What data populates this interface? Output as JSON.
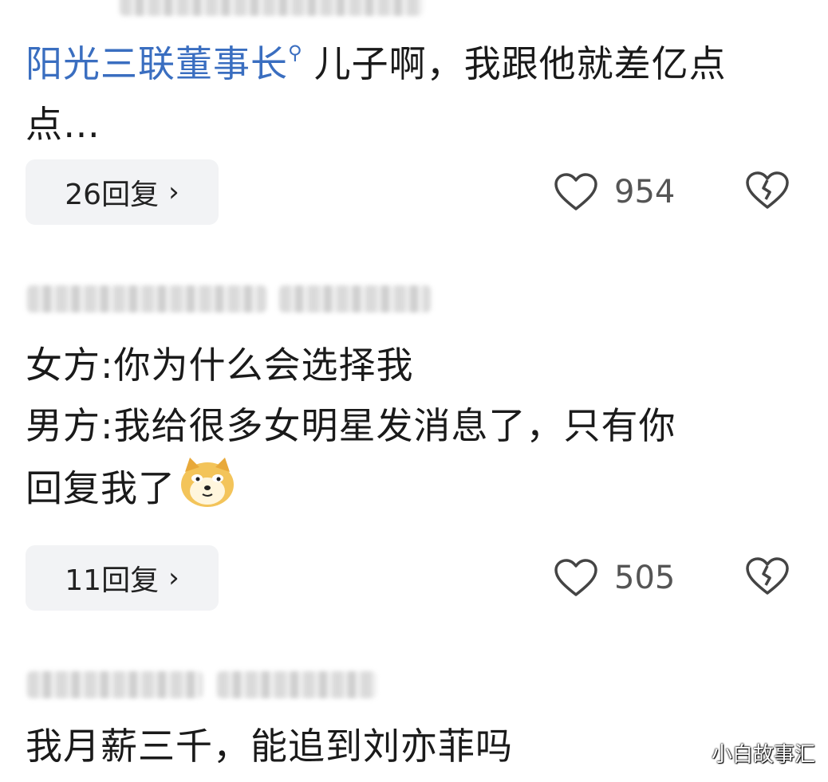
{
  "comments": [
    {
      "username": "阳光三联董事长",
      "text": "儿子啊，我跟他就差亿点点…",
      "reply_label": "26回复",
      "likes": "954"
    },
    {
      "lines": [
        "女方:你为什么会选择我",
        "男方:我给很多女明星发消息了，只有你",
        "回复我了"
      ],
      "emoji": "doge-emoji",
      "reply_label": "11回复",
      "likes": "505"
    },
    {
      "text": "我月薪三千，能追到刘亦菲吗"
    }
  ],
  "watermark": "小白故事汇",
  "icons": {
    "search": "search-icon",
    "like": "heart-icon",
    "dislike": "broken-heart-icon",
    "chevron": "chevron-right-icon"
  }
}
